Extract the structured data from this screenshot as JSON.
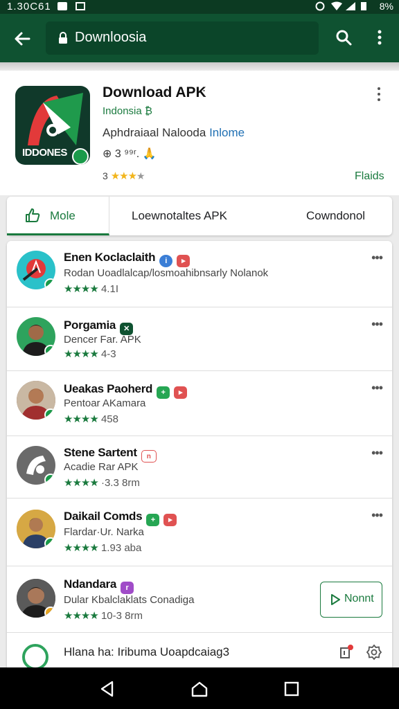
{
  "status_bar": {
    "time": "1.30C61",
    "battery": "8%"
  },
  "browser": {
    "url": "Downloosia"
  },
  "app": {
    "icon_text": "IDDONES",
    "title": "Download APK",
    "title_suffix": ":",
    "developer": "Indonsia ₿",
    "description": "Aphdraiaal Nalooda",
    "description_link": "Inlome",
    "meta": "⊕ 3 ⁹⁹ʳ. 🙏",
    "rating_value": "3",
    "stars_filled": "★★★",
    "stars_empty": "★",
    "fields_link": "Flaids"
  },
  "tabs": [
    {
      "label": "Mole"
    },
    {
      "label": "Loewnotaltes  APK"
    },
    {
      "label": "Cowndonol"
    }
  ],
  "list": [
    {
      "title": "Enen Koclaclaith",
      "subtitle": "Rodan Uoadlalcap/losmoahibnsarly Nolanok",
      "stars": "★★★★",
      "rating": "4.1I",
      "tags": [
        "blue",
        "red"
      ]
    },
    {
      "title": "Porgamia",
      "subtitle": "Dencer Far. APK",
      "stars": "★★★★",
      "rating": "4-3",
      "tags": [
        "dark"
      ]
    },
    {
      "title": "Ueakas Paoherd",
      "subtitle": "Pentoar AKamara",
      "stars": "★★★★",
      "rating": "458",
      "tags": [
        "green",
        "red"
      ]
    },
    {
      "title": "Stene Sartent",
      "subtitle": "Acadie Rar APK",
      "stars": "★★★★",
      "rating": "·3.3 8rm",
      "tags": [
        "outline"
      ]
    },
    {
      "title": "Daikail Comds",
      "subtitle": "Flardar·Ur. Narka",
      "stars": "★★★★",
      "rating": "1.93 aba",
      "tags": [
        "green",
        "red"
      ]
    },
    {
      "title": "Ndandara",
      "subtitle": "Dular Kbalclaklats Conadiga",
      "stars": "★★★★",
      "rating": "10-3 8rm",
      "tags": [
        "purple"
      ]
    }
  ],
  "install_button": {
    "label": "Nonnt"
  },
  "footer": {
    "text": "Hlana ha: Iribuma Uoapdcaiag3"
  },
  "row_menu": "•••"
}
